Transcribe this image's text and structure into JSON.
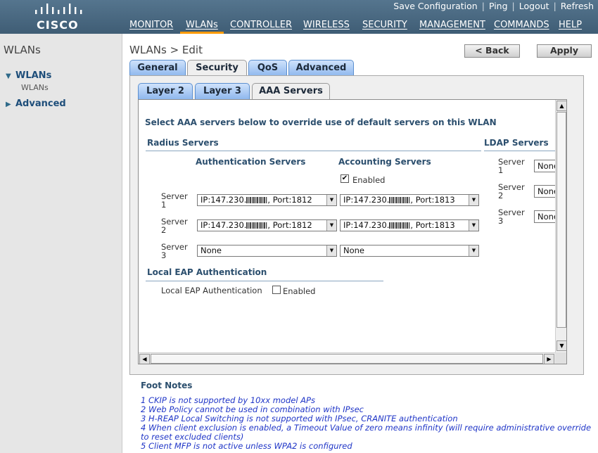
{
  "header": {
    "logo_text": "CISCO",
    "utility_links": [
      "Save Configuration",
      "Ping",
      "Logout",
      "Refresh"
    ],
    "nav": [
      {
        "label": "MONITOR",
        "active": false
      },
      {
        "label": "WLANs",
        "active": true
      },
      {
        "label": "CONTROLLER",
        "active": false
      },
      {
        "label": "WIRELESS",
        "active": false
      },
      {
        "label": "SECURITY",
        "active": false
      },
      {
        "label": "MANAGEMENT",
        "active": false
      },
      {
        "label": "COMMANDS",
        "active": false
      },
      {
        "label": "HELP",
        "active": false
      }
    ]
  },
  "sidebar": {
    "title": "WLANs",
    "items": [
      {
        "label": "WLANs",
        "expanded": true,
        "children": [
          "WLANs"
        ]
      },
      {
        "label": "Advanced",
        "expanded": false
      }
    ]
  },
  "page": {
    "title": "WLANs > Edit",
    "back_button": "< Back",
    "apply_button": "Apply"
  },
  "tabs": {
    "main": [
      "General",
      "Security",
      "QoS",
      "Advanced"
    ],
    "main_selected": "Security",
    "sub": [
      "Layer 2",
      "Layer 3",
      "AAA Servers"
    ],
    "sub_selected": "AAA Servers"
  },
  "aaa": {
    "intro": "Select AAA servers below to override use of default servers on this WLAN",
    "radius_title": "Radius Servers",
    "auth_header": "Authentication Servers",
    "acct_header": "Accounting Servers",
    "acct_enabled_label": "Enabled",
    "acct_enabled_checked": true,
    "servers": [
      {
        "label": "Server 1",
        "auth": {
          "prefix": "IP:147.230.",
          "suffix": ", Port:1812"
        },
        "acct": {
          "prefix": "IP:147.230.",
          "suffix": ", Port:1813"
        }
      },
      {
        "label": "Server 2",
        "auth": {
          "prefix": "IP:147.230.",
          "suffix": ", Port:1812"
        },
        "acct": {
          "prefix": "IP:147.230.",
          "suffix": ", Port:1813"
        }
      },
      {
        "label": "Server 3",
        "auth": {
          "value": "None"
        },
        "acct": {
          "value": "None"
        }
      }
    ],
    "ldap_title": "LDAP Servers",
    "ldap_servers": [
      {
        "label": "Server 1",
        "value": "None"
      },
      {
        "label": "Server 2",
        "value": "None"
      },
      {
        "label": "Server 3",
        "value": "None"
      }
    ],
    "local_eap_title": "Local EAP Authentication",
    "local_eap_label": "Local EAP Authentication",
    "local_eap_enabled_label": "Enabled",
    "local_eap_checked": false
  },
  "footnotes": {
    "title": "Foot Notes",
    "lines": [
      "1 CKIP is not supported by 10xx model APs",
      "2 Web Policy cannot be used in combination with IPsec",
      "3 H-REAP Local Switching is not supported with IPsec, CRANITE authentication",
      "4 When client exclusion is enabled, a Timeout Value of zero means infinity (will require administrative override",
      "to reset excluded clients)",
      "5 Client MFP is not active unless WPA2 is configured"
    ]
  },
  "colors": {
    "header_bg": "#4a6a82",
    "nav_active_underline": "#ff9a00",
    "tab_blue": "#8fb8ee",
    "section_text": "#2c4f6e",
    "footnote_text": "#1f35c7"
  }
}
